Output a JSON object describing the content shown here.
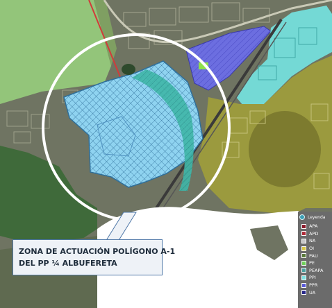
{
  "callout": {
    "line1": "ZONA DE ACTUACIÓN  POLÍGONO A-1",
    "line2": "DEL PP ¼ ALBUFERETA"
  },
  "legend": {
    "title": "Leyenda",
    "items": [
      {
        "label": "APA",
        "color": "#8b1a2b"
      },
      {
        "label": "APD",
        "color": "#b02d3a"
      },
      {
        "label": "NA",
        "color": "#c8c8c8"
      },
      {
        "label": "OI",
        "color": "#d8c84a"
      },
      {
        "label": "PAU",
        "color": "#5a7a3a"
      },
      {
        "label": "PE",
        "color": "#6fcf5a"
      },
      {
        "label": "PEAPA",
        "color": "#4aa0a0"
      },
      {
        "label": "PPI",
        "color": "#7fe0e0"
      },
      {
        "label": "PPR",
        "color": "#5a5ad8"
      },
      {
        "label": "UA",
        "color": "#2a2a8a"
      }
    ]
  },
  "colors": {
    "residential_zone": "#9b9a3e",
    "green_zone": "#93c57a",
    "sea": "#ffffff",
    "focus_area": "#8fd3f0",
    "focus_circle": "#ffffff",
    "blue_zone": "#6c6ee0",
    "cyan_zone": "#74e4e2"
  }
}
